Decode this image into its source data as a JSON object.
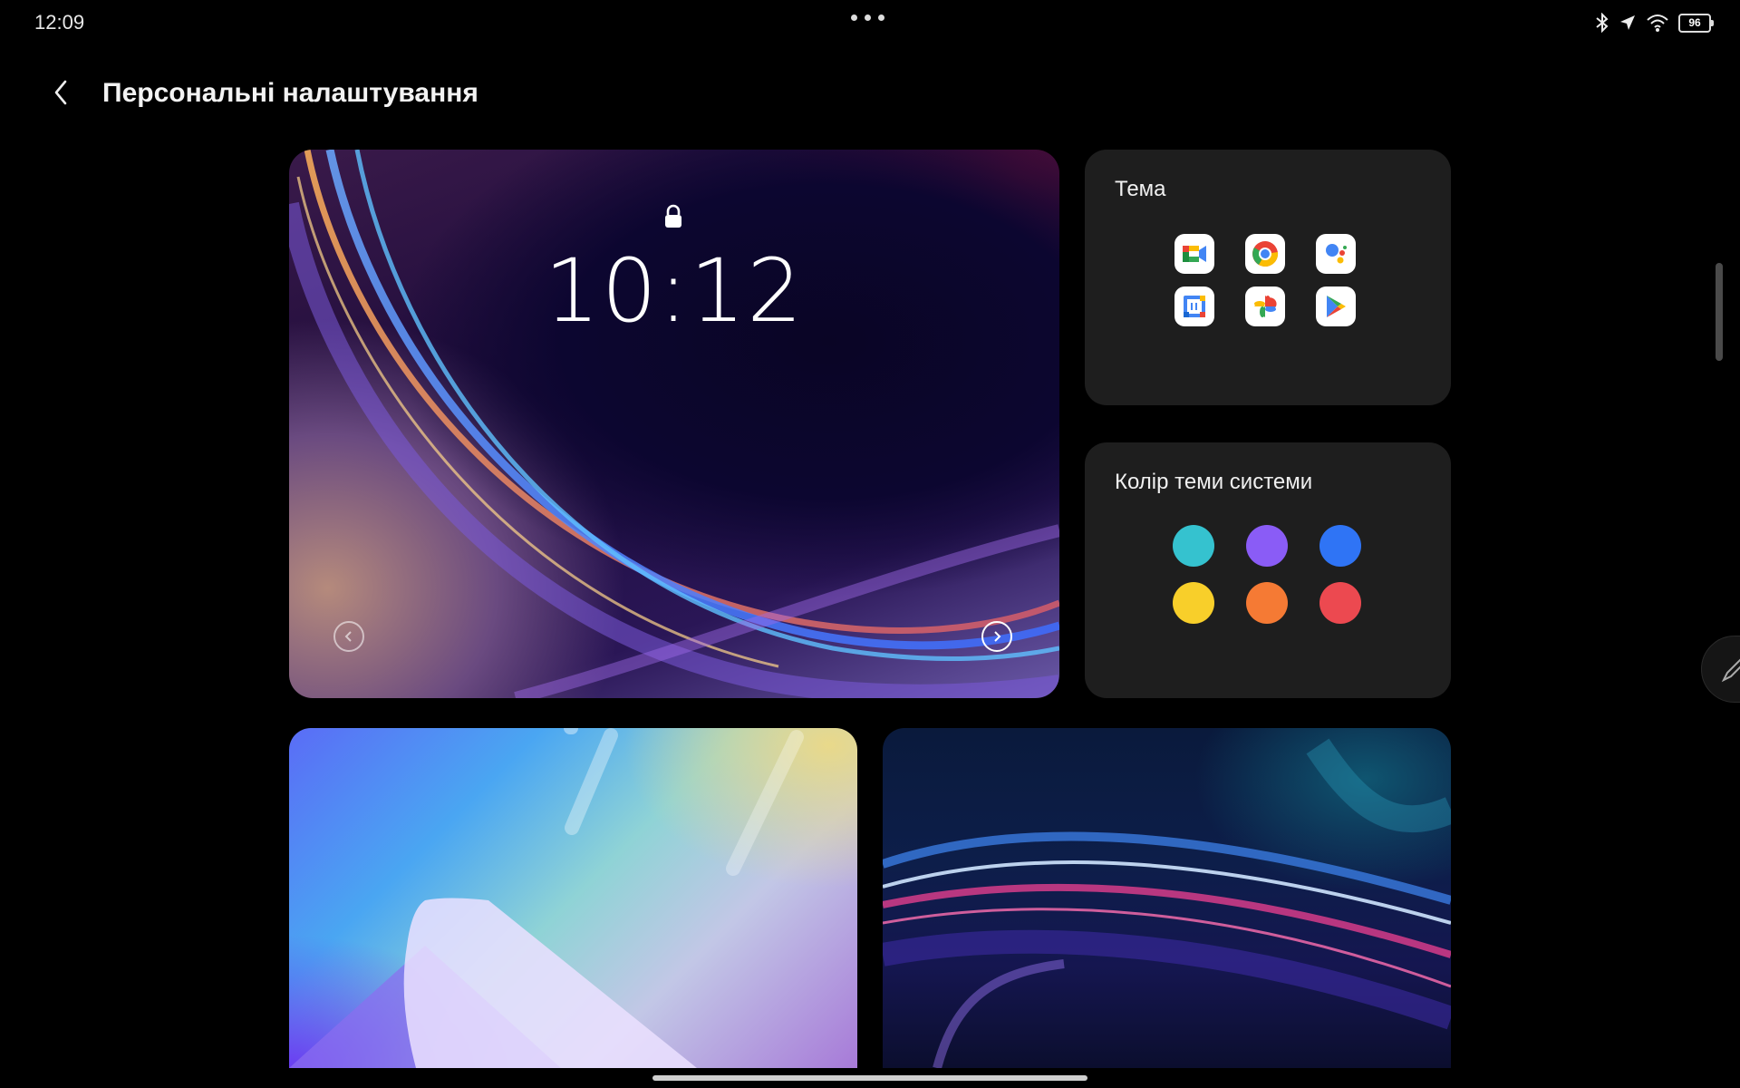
{
  "status_bar": {
    "time": "12:09",
    "battery": "96",
    "icons": [
      "bluetooth-icon",
      "location-arrow-icon",
      "wifi-icon",
      "battery-icon"
    ]
  },
  "header": {
    "title": "Персональні налаштування"
  },
  "preview": {
    "clock": "10:12"
  },
  "theme_card": {
    "title": "Тема",
    "apps": [
      "google-meet-icon",
      "chrome-icon",
      "google-assistant-icon",
      "google-calendar-icon",
      "google-photos-icon",
      "google-play-icon"
    ]
  },
  "color_card": {
    "title": "Колір теми системи",
    "colors": [
      "#35c2cf",
      "#8a5cf6",
      "#2f74f5",
      "#f8cf2a",
      "#f57a34",
      "#ec4950"
    ]
  }
}
